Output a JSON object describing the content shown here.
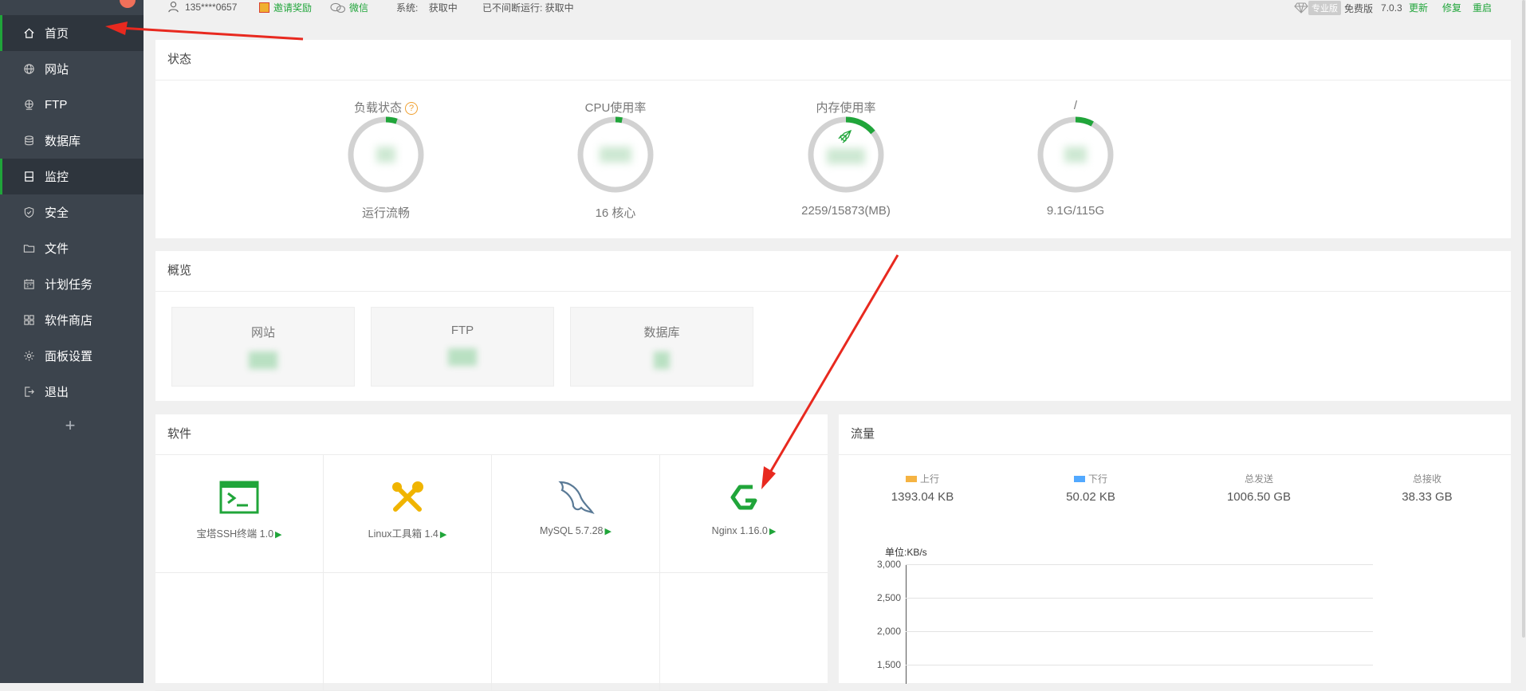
{
  "sidebar": {
    "items": [
      {
        "label": "首页",
        "icon": "home-icon"
      },
      {
        "label": "网站",
        "icon": "globe-icon"
      },
      {
        "label": "FTP",
        "icon": "ftp-icon"
      },
      {
        "label": "数据库",
        "icon": "database-icon"
      },
      {
        "label": "监控",
        "icon": "monitor-icon"
      },
      {
        "label": "安全",
        "icon": "shield-icon"
      },
      {
        "label": "文件",
        "icon": "folder-icon"
      },
      {
        "label": "计划任务",
        "icon": "calendar-icon"
      },
      {
        "label": "软件商店",
        "icon": "grid-icon"
      },
      {
        "label": "面板设置",
        "icon": "gear-icon"
      },
      {
        "label": "退出",
        "icon": "logout-icon"
      }
    ],
    "add_label": "+"
  },
  "topbar": {
    "user": "135****0657",
    "invite": "邀请奖励",
    "wechat": "微信",
    "system_label": "系统:",
    "system_value": "获取中",
    "uptime": "已不间断运行: 获取中",
    "pro_tag": "专业版",
    "edition": "免费版",
    "version": "7.0.3",
    "update": "更新",
    "repair": "修复",
    "restart": "重启"
  },
  "status": {
    "title": "状态",
    "gauges": [
      {
        "label": "负载状态",
        "sub": "运行流畅",
        "level": 0.05,
        "help": "?"
      },
      {
        "label": "CPU使用率",
        "sub": "16 核心",
        "level": 0.03
      },
      {
        "label": "内存使用率",
        "sub": "2259/15873(MB)",
        "level": 0.14
      },
      {
        "label": "/",
        "sub": "9.1G/115G",
        "level": 0.08
      }
    ]
  },
  "overview": {
    "title": "概览",
    "boxes": [
      {
        "label": "网站"
      },
      {
        "label": "FTP"
      },
      {
        "label": "数据库"
      }
    ]
  },
  "software": {
    "title": "软件",
    "items": [
      {
        "name": "宝塔SSH终端 1.0",
        "icon": "terminal-icon"
      },
      {
        "name": "Linux工具箱 1.4",
        "icon": "tools-icon"
      },
      {
        "name": "MySQL 5.7.28",
        "icon": "mysql-dolphin-icon"
      },
      {
        "name": "Nginx 1.16.0",
        "icon": "nginx-icon"
      }
    ],
    "play": "▶"
  },
  "traffic": {
    "title": "流量",
    "up_label": "上行",
    "up_value": "1393.04 KB",
    "down_label": "下行",
    "down_value": "50.02 KB",
    "sent_label": "总发送",
    "sent_value": "1006.50 GB",
    "recv_label": "总接收",
    "recv_value": "38.33 GB",
    "unit": "单位:KB/s",
    "yticks": [
      "3,000",
      "2,500",
      "2,000",
      "1,500"
    ],
    "colors": {
      "up": "#f5b342",
      "down": "#52a9ff"
    }
  },
  "colors": {
    "accent": "#20a53a",
    "sidebar": "#3c444d",
    "arrow": "#e8291f"
  }
}
